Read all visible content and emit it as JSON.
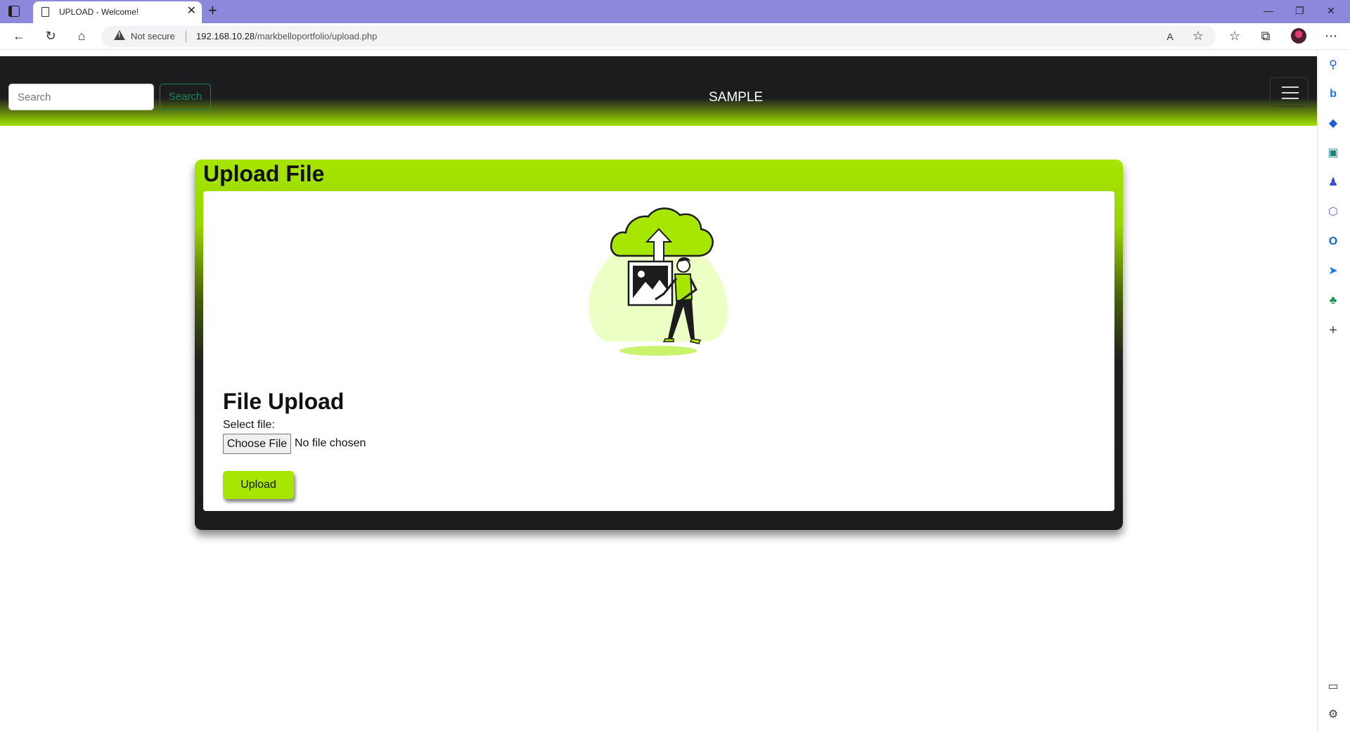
{
  "browser": {
    "tab_title": "UPLOAD - Welcome!",
    "close_glyph": "✕",
    "new_tab_glyph": "+",
    "not_secure": "Not secure",
    "url_host": "192.168.10.28",
    "url_path": "/markbelloportfolio/upload.php",
    "window": {
      "minimize": "—",
      "restore": "❐",
      "close": "✕"
    },
    "toolbar_glyphs": {
      "back": "←",
      "reload": "↻",
      "home": "⌂",
      "read_aloud": "A",
      "favorite": "☆",
      "favorites": "☆",
      "collections": "⧉",
      "more": "⋯"
    },
    "sidebar_glyphs": {
      "search": "⚲",
      "bing": "b",
      "shopping": "◆",
      "tools": "▣",
      "games": "♟",
      "m365": "⬡",
      "outlook": "O",
      "send": "➤",
      "tree": "♣",
      "add": "+",
      "split": "▭",
      "settings": "⚙"
    }
  },
  "site": {
    "search_placeholder": "Search",
    "search_button": "Search",
    "brand": "SAMPLE"
  },
  "card": {
    "title": "Upload File",
    "form_title": "File Upload",
    "select_label": "Select file:",
    "choose_button": "Choose File",
    "no_file_text": "No file chosen",
    "upload_button": "Upload"
  },
  "colors": {
    "accent": "#a6e600",
    "nav_dark": "#1c1c1e",
    "tabbar": "#8c89dc",
    "search_button": "#198754"
  }
}
